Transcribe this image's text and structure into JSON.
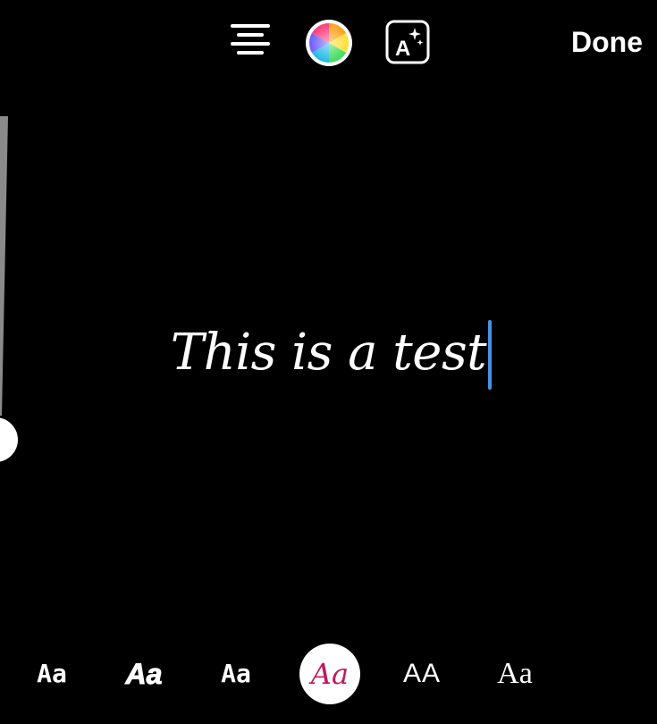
{
  "toolbar": {
    "done_label": "Done",
    "align_icon": "align-center-icon",
    "color_icon": "color-wheel-icon",
    "effects_icon": "text-effects-icon"
  },
  "editor": {
    "text": "This is a test",
    "caret_color": "#4a90e2"
  },
  "font_options": [
    {
      "label": "Aa",
      "icon_name": "font-classic"
    },
    {
      "label": "Aa",
      "icon_name": "font-strong"
    },
    {
      "label": "Aa",
      "icon_name": "font-typewriter"
    },
    {
      "label": "Aa",
      "icon_name": "font-editor",
      "selected": true,
      "color": "#c2185b"
    },
    {
      "label": "AA",
      "icon_name": "font-modern"
    },
    {
      "label": "Aa",
      "icon_name": "font-deco"
    }
  ],
  "effects_glyph": "A"
}
